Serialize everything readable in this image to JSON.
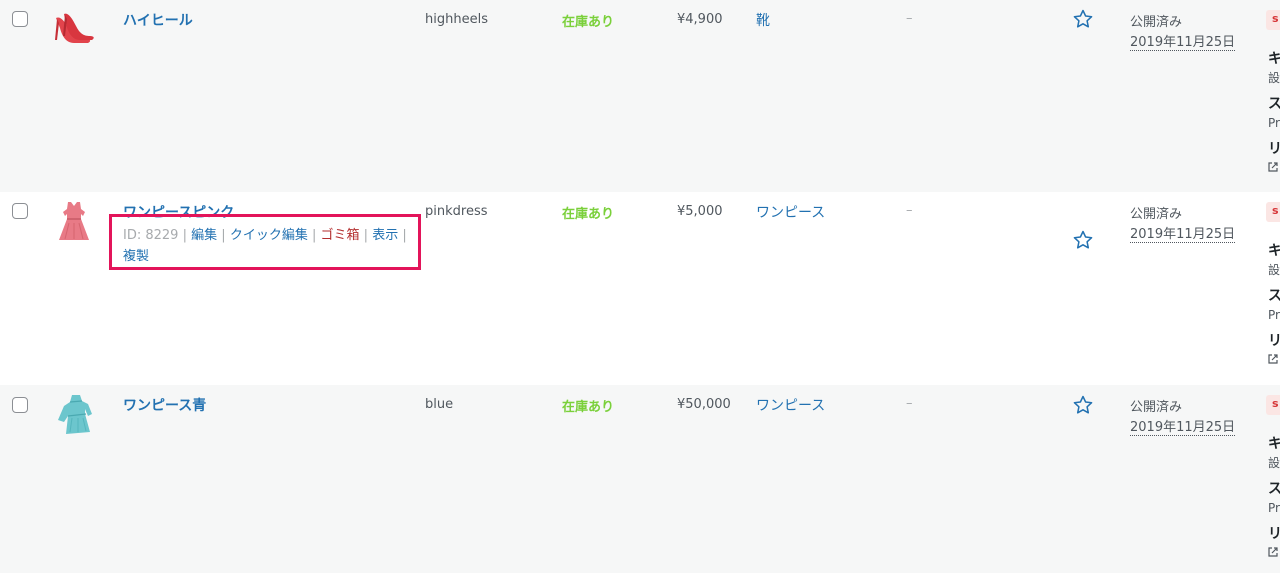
{
  "rows": [
    {
      "name": "ハイヒール",
      "sku": "highheels",
      "stock": "在庫あり",
      "price": "¥4,900",
      "category": "靴",
      "tags": "–",
      "status": "公開済み",
      "date": "2019年11月25日",
      "edge_badge": "ꜱ",
      "edge_lines": [
        "キ",
        "設",
        "ス",
        "Pr",
        "リ"
      ],
      "image_icon": "high-heel-shoe-icon"
    },
    {
      "name": "ワンピースピンク",
      "sku": "pinkdress",
      "stock": "在庫あり",
      "price": "¥5,000",
      "category": "ワンピース",
      "tags": "–",
      "status": "公開済み",
      "date": "2019年11月25日",
      "edge_badge": "ꜱ",
      "edge_lines": [
        "キ",
        "設",
        "ス",
        "Pr",
        "リ"
      ],
      "image_icon": "pink-dress-icon",
      "actions": {
        "id_text": "ID: 8229",
        "edit": "編集",
        "quick_edit": "クイック編集",
        "trash": "ゴミ箱",
        "view": "表示",
        "duplicate": "複製",
        "separator": "|"
      }
    },
    {
      "name": "ワンピース青",
      "sku": "blue",
      "stock": "在庫あり",
      "price": "¥50,000",
      "category": "ワンピース",
      "tags": "–",
      "status": "公開済み",
      "date": "2019年11月25日",
      "edge_badge": "ꜱ",
      "edge_lines": [
        "キ",
        "設",
        "ス",
        "Pr",
        "リ"
      ],
      "image_icon": "blue-dress-icon"
    }
  ],
  "colors": {
    "link": "#2271b1",
    "in_stock": "#7ad03a",
    "trash": "#b32d2e",
    "highlight": "#e3145a",
    "alt_row": "#f6f7f7"
  }
}
